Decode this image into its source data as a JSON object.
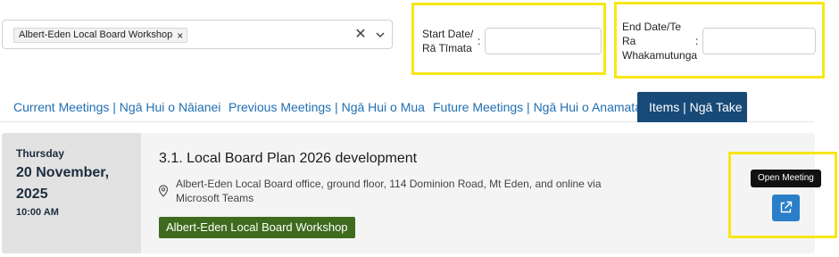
{
  "filter": {
    "selected_chip": "Albert-Eden Local Board Workshop",
    "chip_remove_glyph": "×",
    "clear_glyph": "✕",
    "chevron_icon": "chevron-down-icon"
  },
  "date_filters": {
    "start_label": "Start Date/ Rā Tīmata",
    "end_label_line1": "End Date/Te",
    "end_label_line2": "Ra",
    "end_label_line3": "Whakamutunga",
    "colon": ":",
    "start_value": "",
    "end_value": ""
  },
  "highlight_color": "#f7e617",
  "tabs": [
    {
      "label": "Current Meetings | Ngā Hui o Nāianei",
      "active": false
    },
    {
      "label": "Previous Meetings | Ngā Hui o Mua",
      "active": false
    },
    {
      "label": "Future Meetings | Ngā Hui o Anamata",
      "active": false
    },
    {
      "label": "Items | Ngā Take",
      "active": true
    }
  ],
  "meeting": {
    "day_of_week": "Thursday",
    "date_line1": "20 November,",
    "date_line2": "2025",
    "time": "10:00 AM",
    "title": "3.1. Local Board Plan 2026 development",
    "location_icon": "map-pin-icon",
    "location": "Albert-Eden Local Board office, ground floor, 114 Dominion Road, Mt Eden, and online via Microsoft Teams",
    "board_tag": "Albert-Eden Local Board Workshop",
    "tooltip": "Open Meeting",
    "open_icon": "external-link-icon"
  },
  "colors": {
    "tab_active_bg": "#184a78",
    "tab_link": "#1f6fb2",
    "tag_green": "#3e6b1e",
    "open_button_blue": "#2a7fc8"
  }
}
